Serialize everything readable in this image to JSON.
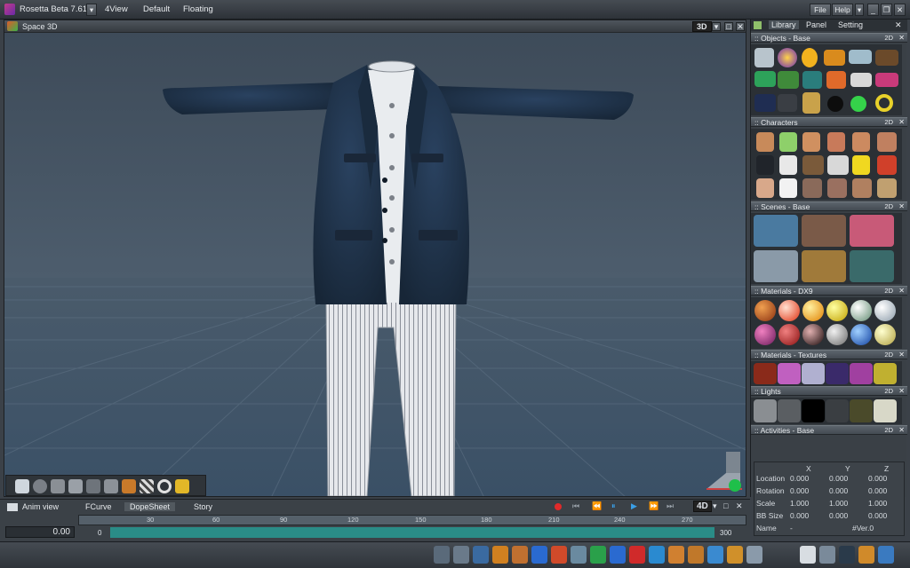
{
  "app": {
    "title": "Rosetta Beta 7.61",
    "menu": [
      "4View",
      "Default",
      "Floating"
    ],
    "right_menu": [
      "File",
      "Help"
    ]
  },
  "viewport": {
    "title": "Space 3D",
    "mode": "3D",
    "colors": {
      "sky": "#3b4a5a",
      "floor": "#3e5264",
      "jacket": "#22364d",
      "pants": "#e3e6ea"
    }
  },
  "tool_icons": [
    "pointer-icon",
    "sphere-tool-icon",
    "cone-tool-icon",
    "plane-tool-icon",
    "cube-tool-icon",
    "light-tool-icon",
    "brush-tool-icon",
    "checker-icon",
    "ring-icon",
    "magic-wand-icon"
  ],
  "panel": {
    "tabs": [
      "Library",
      "Panel",
      "Setting"
    ],
    "sections": [
      {
        "title": ":: Objects - Base",
        "mode": "2D"
      },
      {
        "title": ":: Characters",
        "mode": "2D"
      },
      {
        "title": ":: Scenes - Base",
        "mode": "2D"
      },
      {
        "title": ":: Materials - DX9",
        "mode": "2D"
      },
      {
        "title": ":: Materials - Textures",
        "mode": "2D"
      },
      {
        "title": ":: Lights",
        "mode": "2D"
      },
      {
        "title": ":: Activities - Base",
        "mode": "2D"
      }
    ],
    "properties": {
      "headers": [
        "X",
        "Y",
        "Z"
      ],
      "rows": [
        {
          "label": "Location",
          "values": [
            "0.000",
            "0.000",
            "0.000"
          ]
        },
        {
          "label": "Rotation",
          "values": [
            "0.000",
            "0.000",
            "0.000"
          ]
        },
        {
          "label": "Scale",
          "values": [
            "1.000",
            "1.000",
            "1.000"
          ]
        },
        {
          "label": "BB Size",
          "values": [
            "0.000",
            "0.000",
            "0.000"
          ]
        }
      ],
      "name_label": "Name",
      "name_dash": "-",
      "name_value": "#Ver.0"
    }
  },
  "timeline": {
    "tabs": [
      "Anim view",
      "FCurve",
      "DopeSheet",
      "Story"
    ],
    "mode": "4D",
    "frame": "0.00",
    "start": "0",
    "end": "300",
    "ticks": [
      "30",
      "60",
      "90",
      "120",
      "150",
      "180",
      "210",
      "240",
      "270"
    ]
  }
}
